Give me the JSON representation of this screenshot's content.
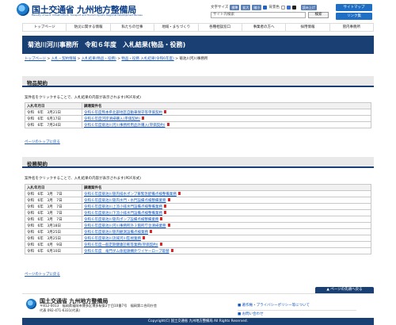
{
  "header": {
    "org_name": "国土交通省 九州地方整備局",
    "org_name_en": "Ministry of Land, Infrastructure, Transport and Tourism Kyushu Regional Development Bureau",
    "text_size_label": "文字サイズ",
    "size_options": [
      "標準",
      "拡大",
      "縮小"
    ],
    "bg_color_label": "背景色",
    "reading_label": "読み上げ",
    "search_placeholder": "サイト内検索",
    "search_button": "検索",
    "sitemap": "サイトマップ",
    "links": "リンク集"
  },
  "gnav": [
    "トップページ",
    "防災に関する情報",
    "私たちの仕事",
    "地域・まちづくり",
    "各種相談窓口",
    "事業者の方へ",
    "採用情報",
    "管内事務所"
  ],
  "page_title": "菊池川河川事務所　令和６年度　入札結果(物品・役務)",
  "breadcrumb": {
    "items": [
      "トップページ",
      "入札・契約情報",
      "入札結果(物品・役務)",
      "物品・役務 入札結果(令和6年度)"
    ],
    "separator": ">",
    "current": "菊池川河川事務所"
  },
  "sections": [
    {
      "heading": "物品契約",
      "note": "案件名をクリックすることで、入札結果の内容が表示されます(PDF形式)",
      "col_date": "入札年月日",
      "col_name": "調達案件名",
      "rows": [
        {
          "date": "令和　6年　3月21日",
          "name": "令和６年度熊本県北部地区自動車保守等単価契約"
        },
        {
          "date": "令和　6年　6月17日",
          "name": "令和６年度河岸清掃購入(単価契約)"
        },
        {
          "date": "令和　6年　7月24日",
          "name": "令和６年度菊池川河川事務所用品外購入(単価契約)"
        }
      ],
      "totop": "ページのトップに戻る"
    },
    {
      "heading": "役務契約",
      "note": "案件名をクリックすることで、入札結果の内容が表示されます(PDF形式)",
      "col_date": "入札年月日",
      "col_name": "調達案件名",
      "rows": [
        {
          "date": "令和　6年　3月　7日",
          "name": "令和６年度菊池川管内排水ポンプ車緊急配備点検整備業務"
        },
        {
          "date": "令和　6年　3月　7日",
          "name": "令和６年度菊池川管内水門・水門設備点検整備業務"
        },
        {
          "date": "令和　6年　3月　7日",
          "name": "令和６年度菊池川上流小排水門設備点検整備業務"
        },
        {
          "date": "令和　6年　3月　7日",
          "name": "令和６年度菊池川下流小排水門設備点検整備業務"
        },
        {
          "date": "令和　6年　3月　7日",
          "name": "令和６年度菊池川管内ポンプ設備点検整備業務"
        },
        {
          "date": "令和　6年　3月18日",
          "name": "令和６年度菊池川河川事務所外３箇所庁舎清掃業務"
        },
        {
          "date": "令和　6年　3月25日",
          "name": "令和６年度菊池川管内観測設備点検業務"
        },
        {
          "date": "令和　6年　3月25日",
          "name": "令和６年度菊池川流域河川監視業務"
        },
        {
          "date": "令和　6年　4月　9日",
          "name": "令和６年度一般定期健康診断等業務(単価契約)"
        },
        {
          "date": "令和　6年　6月10日",
          "name": "令和６年度　竜門ダム係船鉄構外ワイヤーロープ取替"
        }
      ],
      "totop": "ページのトップに戻る"
    }
  ],
  "pagetop_button": "▲ ページの先頭へ戻る",
  "footer": {
    "name": "国土交通省 九州地方整備局",
    "address": "〒812-0013　福岡県福岡市博多区博多駅東2丁目10番7号　福岡第二合同庁舎",
    "tel": "代表 092-471-6331(代表)",
    "link1": "■ 著作権・プライバシーポリシー等について",
    "link2": "■ お問い合わせ"
  },
  "copyright": "Copyright(C) 国土交通省 九州地方整備局 All Rights Reserved."
}
